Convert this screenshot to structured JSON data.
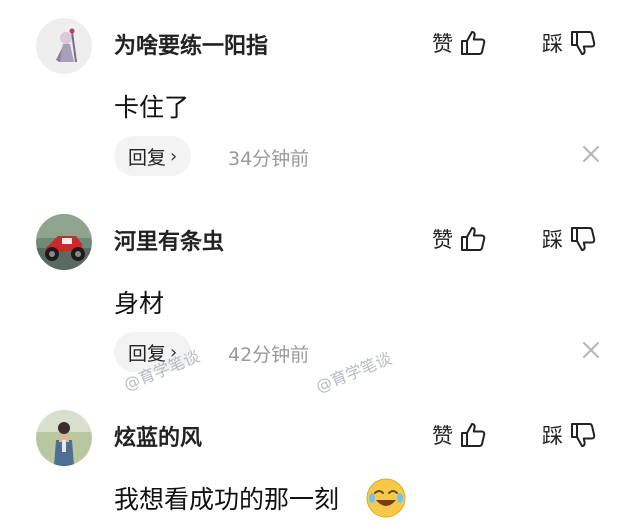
{
  "comments": [
    {
      "username": "为啥要练一阳指",
      "text": "卡住了",
      "like_label": "赞",
      "dislike_label": "踩",
      "reply_label": "回复",
      "time": "34分钟前"
    },
    {
      "username": "河里有条虫",
      "text": "身材",
      "like_label": "赞",
      "dislike_label": "踩",
      "reply_label": "回复",
      "time": "42分钟前"
    },
    {
      "username": "炫蓝的风",
      "text": "我想看成功的那一刻",
      "like_label": "赞",
      "dislike_label": "踩",
      "emoji": "laughing-tears-emoji"
    }
  ],
  "watermark": "@育学笔谈",
  "icons": {
    "like": "thumbs-up-icon",
    "dislike": "thumbs-down-icon",
    "close": "close-icon",
    "chevron": "chevron-right-icon"
  },
  "colors": {
    "text": "#111111",
    "muted": "#9a9a9a",
    "pill_bg": "#f3f3f3",
    "watermark": "#aab0b8"
  }
}
